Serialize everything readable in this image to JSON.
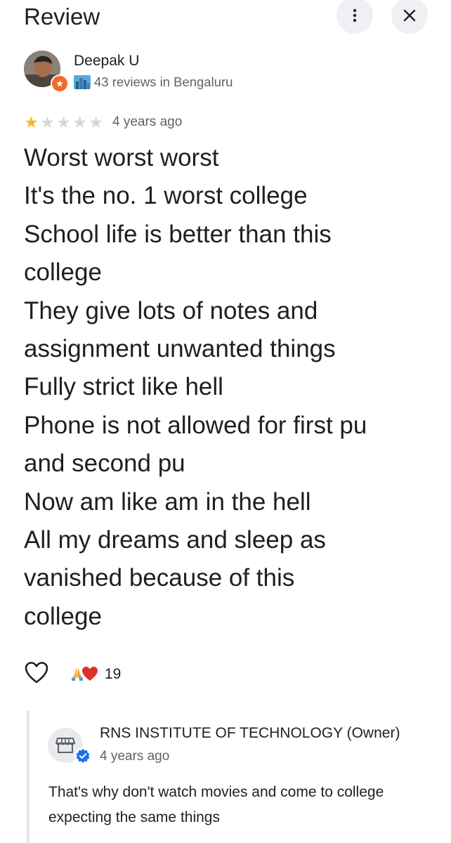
{
  "header": {
    "title": "Review",
    "more_icon": "more-vert-icon",
    "close_icon": "close-icon"
  },
  "reviewer": {
    "name": "Deepak U",
    "reviews_info": "43 reviews in Bengaluru",
    "badge_icon": "local-guide-icon",
    "city_icon": "city-icon"
  },
  "review": {
    "rating": 1,
    "max_rating": 5,
    "date": "4 years ago",
    "lines": [
      "Worst worst worst",
      "It's the no. 1 worst college",
      "School life is better than this",
      "college",
      "They give lots of notes and",
      "assignment unwanted things",
      "Fully strict like hell",
      "Phone is not allowed for first pu",
      "and second pu",
      "Now am like am in the hell",
      "All my dreams and sleep as",
      "vanished because of this",
      "college"
    ]
  },
  "reactions": {
    "count": "19",
    "like_icon": "heart-outline-icon",
    "emojis": [
      "pray-icon",
      "heart-icon"
    ]
  },
  "owner_reply": {
    "name": "RNS INSTITUTE OF TECHNOLOGY (Owner)",
    "date": "4 years ago",
    "text": "That's why don't watch movies and come to college expecting the same things",
    "avatar_icon": "storefront-icon",
    "badge_icon": "verified-icon"
  },
  "colors": {
    "star_filled": "#f7b928",
    "star_empty": "#d5d7da",
    "secondary_text": "#5f6368",
    "verified_blue": "#1a73e8",
    "guide_orange": "#f06a2d"
  }
}
